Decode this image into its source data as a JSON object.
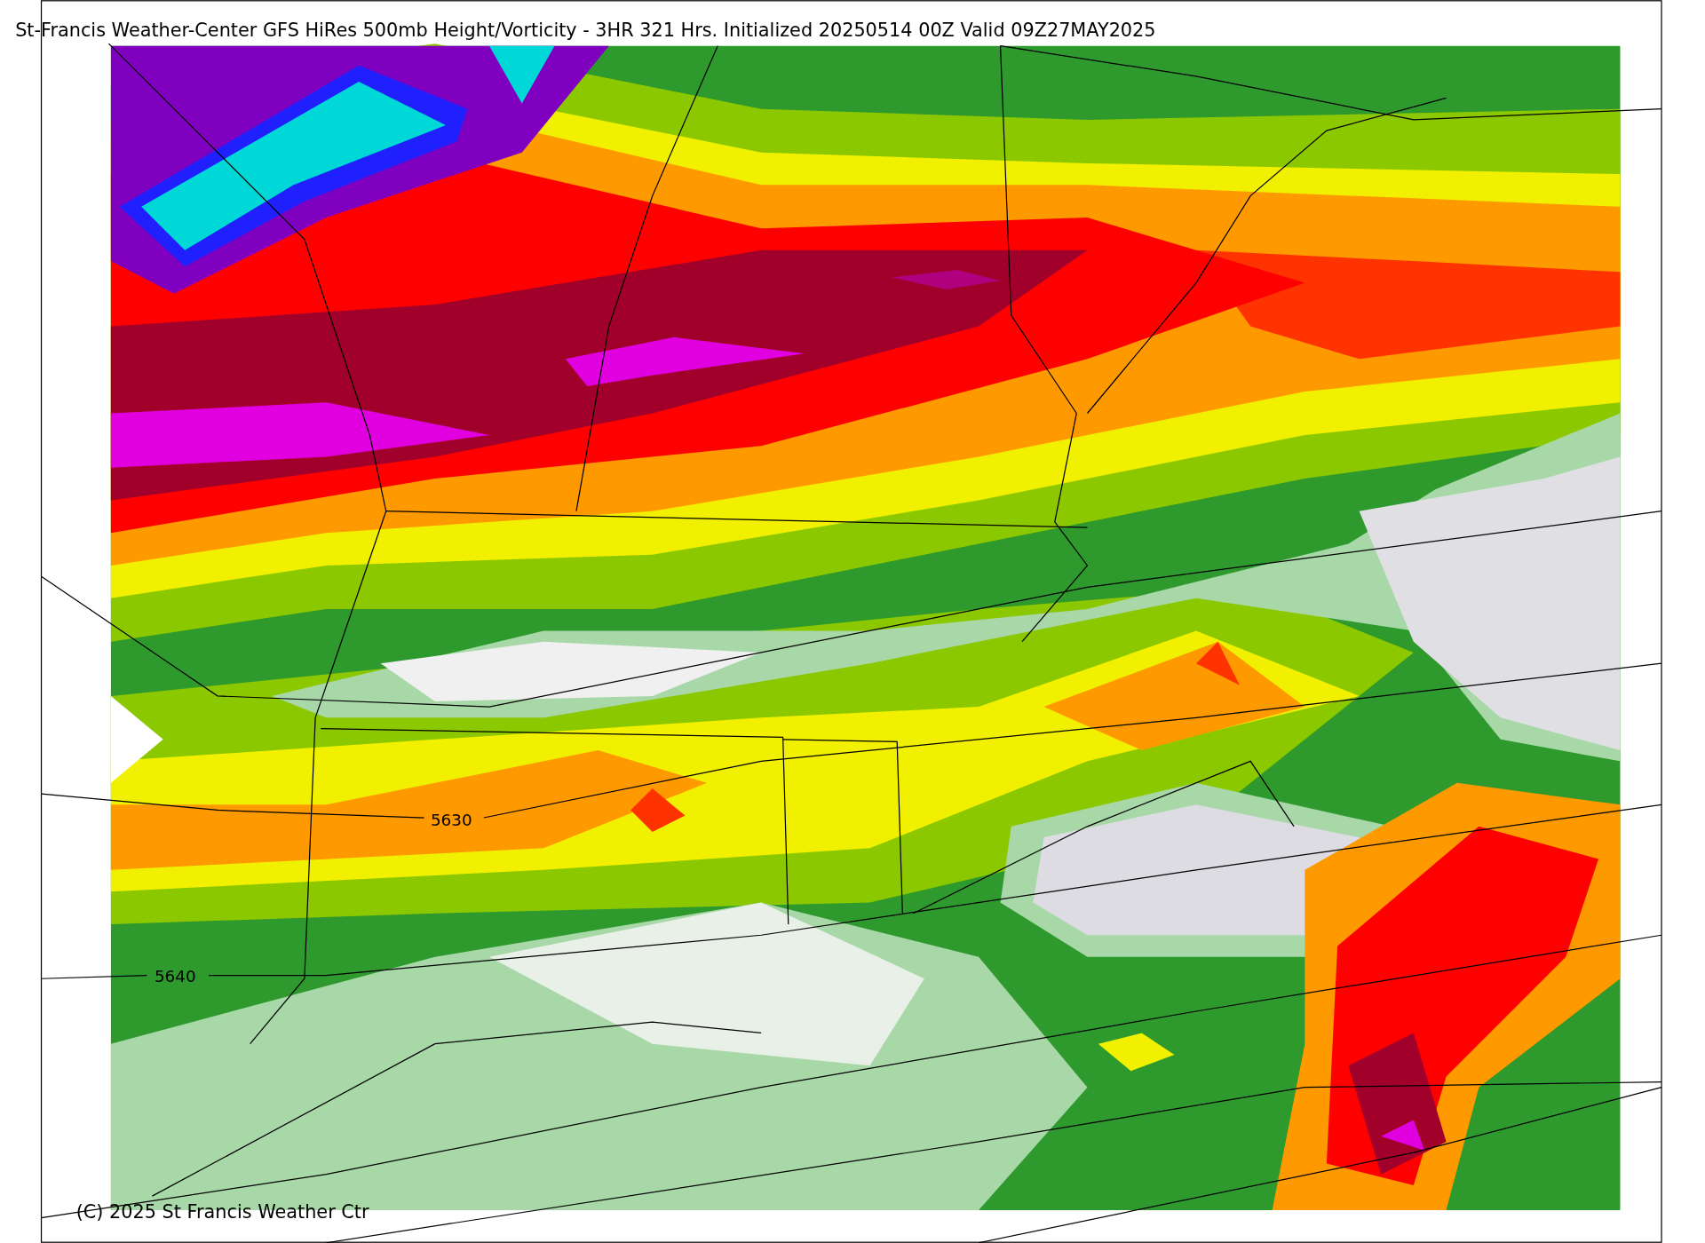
{
  "title": "St-Francis Weather-Center GFS HiRes 500mb Height/Vorticity - 3HR  321 Hrs.  Initialized 20250514 00Z Valid 09Z27MAY2025",
  "contour_labels": [
    "5630",
    "5640"
  ],
  "copyright": "(C) 2025 St Francis Weather Ctr"
}
